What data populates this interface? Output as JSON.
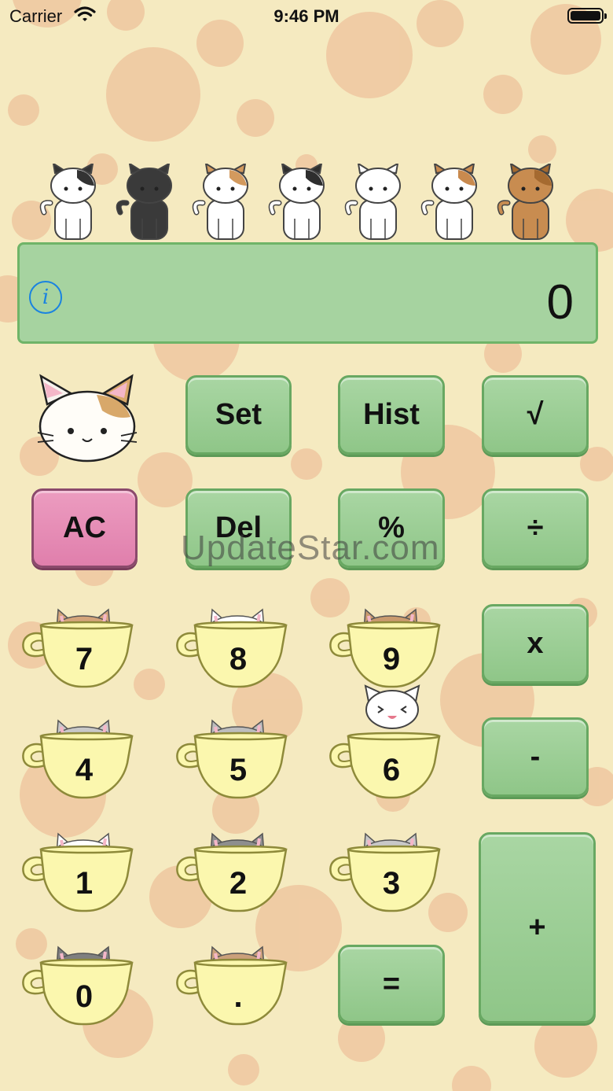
{
  "status_bar": {
    "carrier": "Carrier",
    "time": "9:46 PM"
  },
  "display": {
    "value": "0",
    "info_label": "i"
  },
  "keys": {
    "set": "Set",
    "hist": "Hist",
    "sqrt": "√",
    "ac": "AC",
    "del": "Del",
    "percent": "%",
    "divide": "÷",
    "multiply": "x",
    "minus": "-",
    "plus": "+",
    "equals": "=",
    "seven": "7",
    "eight": "8",
    "nine": "9",
    "four": "4",
    "five": "5",
    "six": "6",
    "one": "1",
    "two": "2",
    "three": "3",
    "zero": "0",
    "dot": "."
  },
  "watermark": "UpdateStar.com",
  "colors": {
    "background": "#f5eac0",
    "spots": "#eec7a0",
    "display": "#a6d3a0",
    "key_green": "#9dcf96",
    "key_pink": "#e68db6",
    "cup": "#fbf7ae",
    "info_blue": "#1a83e0"
  },
  "icons": [
    "wifi-icon",
    "battery-icon",
    "info-icon",
    "cat-mascot-icon",
    "teacup-icon"
  ]
}
